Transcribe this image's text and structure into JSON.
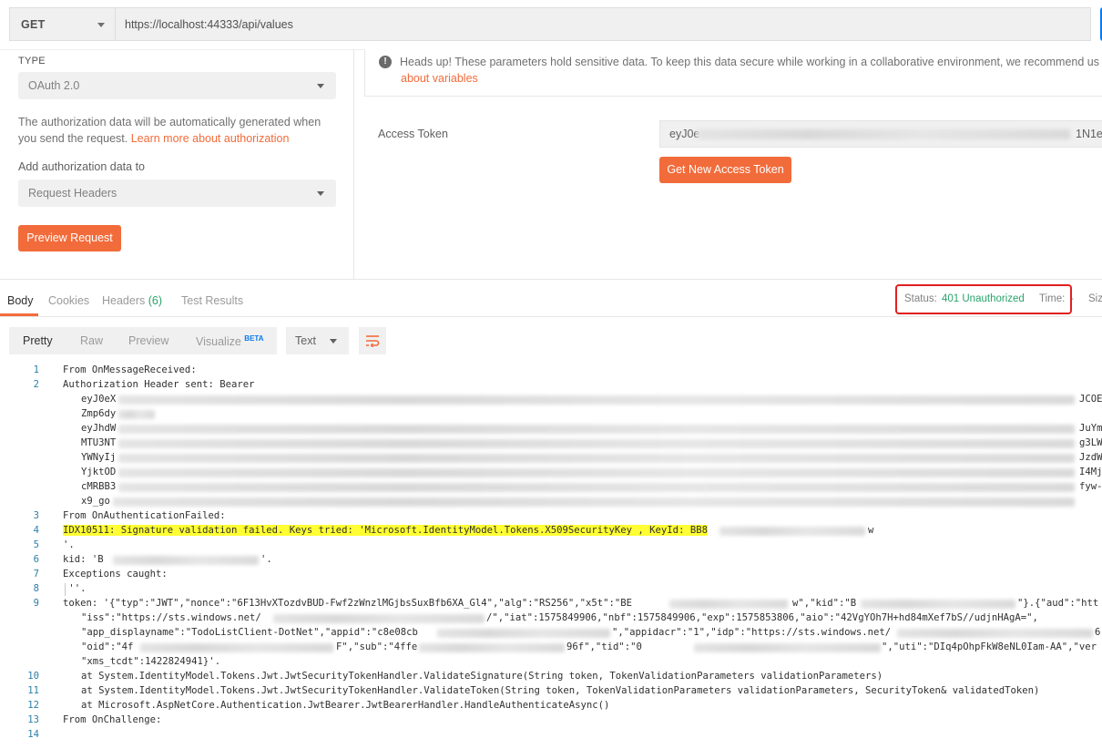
{
  "request": {
    "method": "GET",
    "url": "https://localhost:44333/api/values"
  },
  "auth": {
    "type_label": "TYPE",
    "type_value": "OAuth 2.0",
    "info_text": "The authorization data will be automatically generated when you send the request.",
    "info_text_line1": "The authorization data will be automatically generated when",
    "info_text_line2": "you send the request.",
    "learn_more_link": "Learn more about authorization",
    "add_to_label": "Add authorization data to",
    "add_to_value": "Request Headers",
    "preview_button": "Preview Request"
  },
  "notice": {
    "text": "Heads up! These parameters hold sensitive data. To keep this data secure while working in a collaborative environment, we recommend us",
    "link": "about variables"
  },
  "token": {
    "label": "Access Token",
    "value_start": "eyJ0e",
    "value_end": "1N1e",
    "get_new_button": "Get New Access Token"
  },
  "response_tabs": {
    "body": "Body",
    "cookies": "Cookies",
    "headers": "Headers",
    "headers_count": "(6)",
    "test_results": "Test Results"
  },
  "status": {
    "label": "Status:",
    "value": "401 Unauthorized",
    "time_label": "Time:",
    "time_value": "-",
    "size_label": "Siz"
  },
  "body_toolbar": {
    "pretty": "Pretty",
    "raw": "Raw",
    "preview": "Preview",
    "visualize": "Visualize",
    "beta": "BETA",
    "format": "Text"
  },
  "colors": {
    "accent_orange": "#f26b3a",
    "status_green": "#2aa36b",
    "highlight_yellow": "#ffff33",
    "annotation_red": "#e02020"
  },
  "code_lines": {
    "l1": "From OnMessageReceived:",
    "l2": "Authorization Header sent: Bearer",
    "w1": "eyJ0eX",
    "w1e": "JCOE",
    "w2": "Zmp6dy",
    "w3": "eyJhdW",
    "w3e": "JuYm",
    "w4": "MTU3NT",
    "w4e": "g3LW",
    "w5": "YWNyIj",
    "w5e": "JzdW",
    "w6": "YjktOD",
    "w6e": "I4Mj",
    "w7": "cMRBB3",
    "w7e": "fyw-",
    "w8": "x9_go",
    "l3": "From OnAuthenticationFailed:",
    "l4": "IDX10511: Signature validation failed. Keys tried: 'Microsoft.IdentityModel.Tokens.X509SecurityKey , KeyId: BB8",
    "l4e": "w",
    "l5": "'.",
    "l6a": "kid: 'B",
    "l6b": "'.",
    "l7": "Exceptions caught:",
    "l8": " ''.",
    "l9": "token: '{\"typ\":\"JWT\",\"nonce\":\"6F13HvXTozdvBUD-Fwf2zWnzlMGjbsSuxBfb6XA_Gl4\",\"alg\":\"RS256\",\"x5t\":\"BE",
    "l9b": "w\",\"kid\":\"B",
    "l9c": "\"}.{\"aud\":\"htt",
    "l9w1a": "\"iss\":\"https://sts.windows.net/",
    "l9w1b": "/\",\"iat\":1575849906,\"nbf\":1575849906,\"exp\":1575853806,\"aio\":\"42VgYOh7H+hd84mXef7bS//udjnHAgA=\",",
    "l9w2a": "\"app_displayname\":\"TodoListClient-DotNet\",\"appid\":\"c8e08cb",
    "l9w2b": "\",\"appidacr\":\"1\",\"idp\":\"https://sts.windows.net/",
    "l9w2c": "6",
    "l9w3a": "\"oid\":\"4f",
    "l9w3b": "F\",\"sub\":\"4ffe",
    "l9w3c": "96f\",\"tid\":\"0",
    "l9w3d": "\",\"uti\":\"DIq4pOhpFkW8eNL0Iam-AA\",\"ver",
    "l9w4": "\"xms_tcdt\":1422824941}'.",
    "l10": "at System.IdentityModel.Tokens.Jwt.JwtSecurityTokenHandler.ValidateSignature(String token, TokenValidationParameters validationParameters)",
    "l11": "at System.IdentityModel.Tokens.Jwt.JwtSecurityTokenHandler.ValidateToken(String token, TokenValidationParameters validationParameters, SecurityToken& validatedToken)",
    "l12": "at Microsoft.AspNetCore.Authentication.JwtBearer.JwtBearerHandler.HandleAuthenticateAsync()",
    "l13": "From OnChallenge:"
  },
  "line_numbers": [
    "1",
    "2",
    "3",
    "4",
    "5",
    "6",
    "7",
    "8",
    "9",
    "10",
    "11",
    "12",
    "13",
    "14"
  ]
}
